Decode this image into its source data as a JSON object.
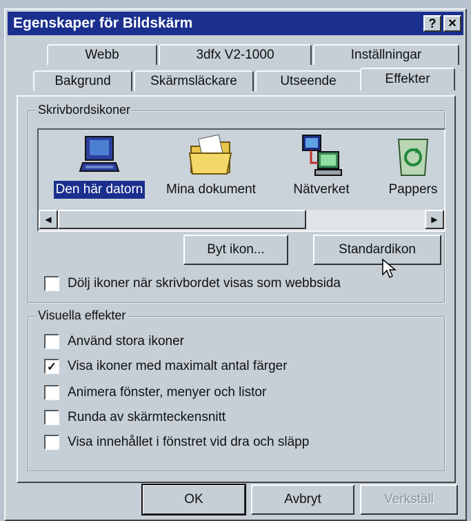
{
  "window": {
    "title": "Egenskaper för Bildskärm"
  },
  "titlebar_buttons": {
    "help": "?",
    "close": "✕"
  },
  "tabs_back": [
    "Webb",
    "3dfx V2-1000",
    "Inställningar"
  ],
  "tabs_front": [
    "Bakgrund",
    "Skärmsläckare",
    "Utseende",
    "Effekter"
  ],
  "active_tab": "Effekter",
  "desktop_icons": {
    "group_title": "Skrivbordsikoner",
    "items": [
      {
        "label": "Den här datorn",
        "icon": "my-computer-icon",
        "selected": true
      },
      {
        "label": "Mina dokument",
        "icon": "folder-icon",
        "selected": false
      },
      {
        "label": "Nätverket",
        "icon": "network-icon",
        "selected": false
      },
      {
        "label": "Pappers",
        "icon": "recycle-bin-icon",
        "selected": false
      }
    ],
    "change_icon_button": "Byt ikon...",
    "default_icon_button": "Standardikon",
    "hide_icons_checkbox": {
      "label": "Dölj ikoner när skrivbordet visas som webbsida",
      "checked": false
    }
  },
  "visual_effects": {
    "group_title": "Visuella effekter",
    "options": [
      {
        "label": "Använd stora ikoner",
        "checked": false
      },
      {
        "label": "Visa ikoner med maximalt antal färger",
        "checked": true
      },
      {
        "label": "Animera fönster, menyer och listor",
        "checked": false
      },
      {
        "label": "Runda av skärmteckensnitt",
        "checked": false
      },
      {
        "label": "Visa innehållet i fönstret vid dra och släpp",
        "checked": false
      }
    ]
  },
  "dialog_buttons": {
    "ok": "OK",
    "cancel": "Avbryt",
    "apply": "Verkställ"
  },
  "colors": {
    "titlebar": "#1a2f8e",
    "face": "#c6cfd6",
    "selection": "#1a2f8e"
  }
}
